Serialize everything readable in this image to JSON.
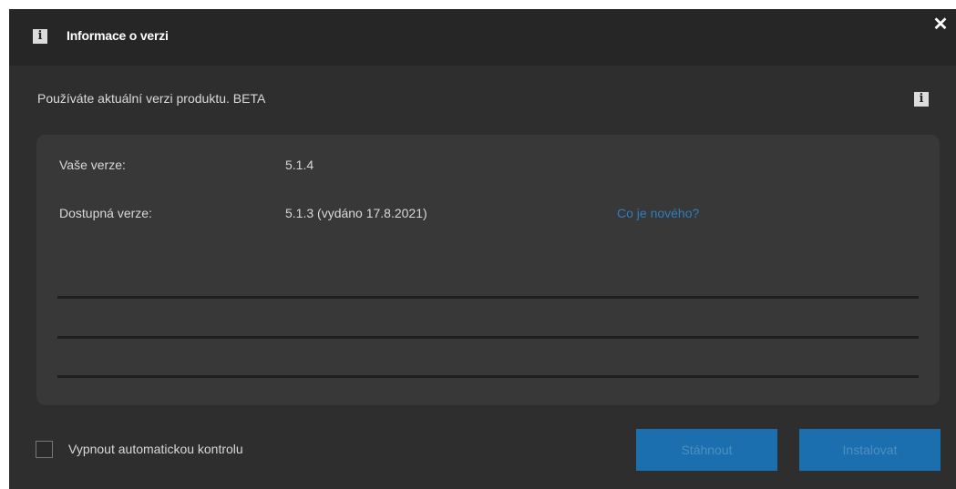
{
  "window": {
    "title": "Informace o verzi",
    "title_icon": "info-icon",
    "close_glyph": "✕"
  },
  "status": {
    "message": "Používáte aktuální verzi produktu. BETA",
    "info_icon_glyph": "i"
  },
  "versions": {
    "current_label": "Vaše verze:",
    "current_value": "5.1.4",
    "available_label": "Dostupná verze:",
    "available_value": "5.1.3 (vydáno 17.8.2021)",
    "whats_new_link": "Co je nového?"
  },
  "footer": {
    "auto_check_label": "Vypnout automatickou kontrolu",
    "auto_check_checked": false,
    "download_button": "Stáhnout",
    "install_button": "Instalovat"
  },
  "colors": {
    "background": "#2e2e2e",
    "titlebar": "#262626",
    "panel": "#383838",
    "link": "#2b7fc1",
    "button": "#1b6fae"
  }
}
